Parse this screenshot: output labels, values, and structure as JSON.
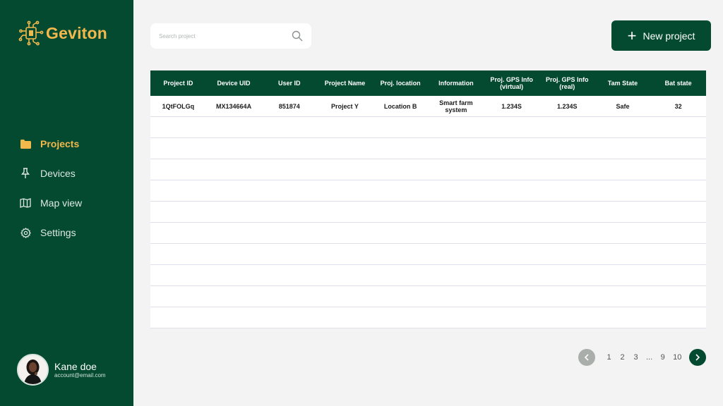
{
  "app": {
    "name": "Geviton"
  },
  "sidebar": {
    "items": [
      {
        "label": "Projects",
        "icon": "folder-icon",
        "active": true
      },
      {
        "label": "Devices",
        "icon": "pin-icon",
        "active": false
      },
      {
        "label": "Map view",
        "icon": "map-icon",
        "active": false
      },
      {
        "label": "Settings",
        "icon": "gear-icon",
        "active": false
      }
    ],
    "user": {
      "name": "Kane doe",
      "email": "account@email.com"
    }
  },
  "search": {
    "placeholder": "Search project"
  },
  "toolbar": {
    "new_project_label": "New project"
  },
  "table": {
    "headers": [
      "Project ID",
      "Device UID",
      "User ID",
      "Project Name",
      "Proj. location",
      "Information",
      "Proj. GPS Info (virtual)",
      "Proj. GPS Info (real)",
      "Tam State",
      "Bat state"
    ],
    "rows": [
      [
        "1QtFOLGq",
        "MX134664A",
        "851874",
        "Project Y",
        "Location B",
        "Smart farm system",
        "1.234S",
        "1.234S",
        "Safe",
        "32"
      ],
      [
        "",
        "",
        "",
        "",
        "",
        "",
        "",
        "",
        "",
        ""
      ],
      [
        "",
        "",
        "",
        "",
        "",
        "",
        "",
        "",
        "",
        ""
      ],
      [
        "",
        "",
        "",
        "",
        "",
        "",
        "",
        "",
        "",
        ""
      ],
      [
        "",
        "",
        "",
        "",
        "",
        "",
        "",
        "",
        "",
        ""
      ],
      [
        "",
        "",
        "",
        "",
        "",
        "",
        "",
        "",
        "",
        ""
      ],
      [
        "",
        "",
        "",
        "",
        "",
        "",
        "",
        "",
        "",
        ""
      ],
      [
        "",
        "",
        "",
        "",
        "",
        "",
        "",
        "",
        "",
        ""
      ],
      [
        "",
        "",
        "",
        "",
        "",
        "",
        "",
        "",
        "",
        ""
      ],
      [
        "",
        "",
        "",
        "",
        "",
        "",
        "",
        "",
        "",
        ""
      ],
      [
        "",
        "",
        "",
        "",
        "",
        "",
        "",
        "",
        "",
        ""
      ]
    ]
  },
  "pagination": {
    "pages": [
      "1",
      "2",
      "3",
      "...",
      "9",
      "10"
    ]
  },
  "colors": {
    "primary": "#034a31",
    "accent": "#f2b84b",
    "background": "#f2f3f2"
  }
}
